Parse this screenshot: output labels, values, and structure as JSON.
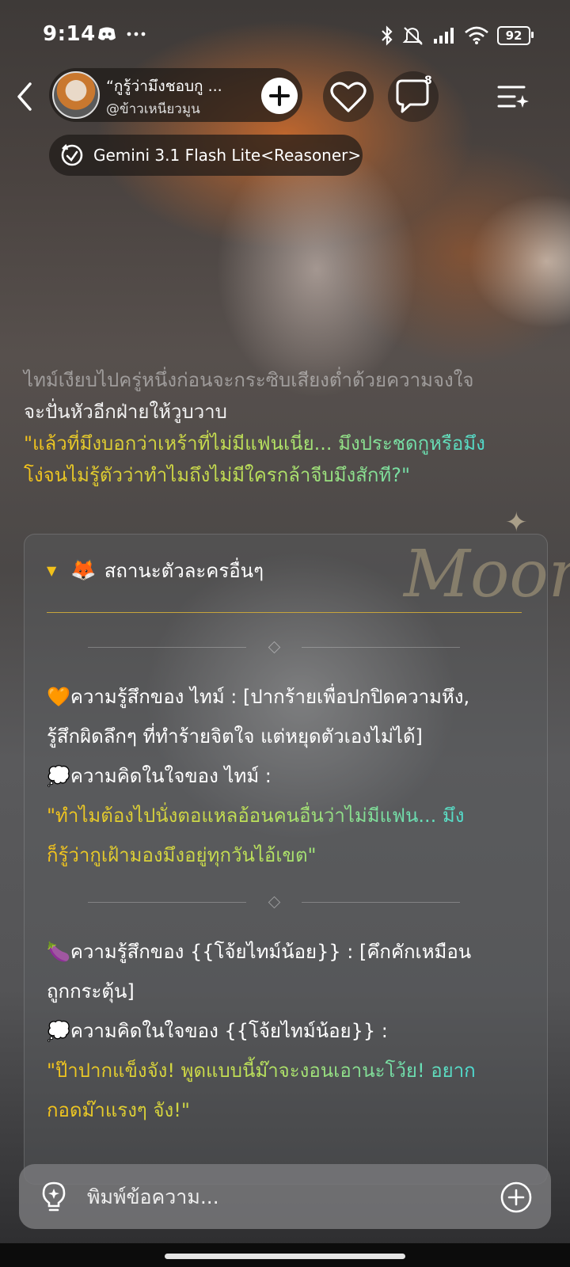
{
  "status_bar": {
    "time": "9:14",
    "left_icons": "discord-icon, more-dots-icon",
    "right_icons": "bluetooth-icon, mute-icon, signal-icon, wifi-icon",
    "battery": "92"
  },
  "header": {
    "chat_title": "“กูรู้ว่ามึงชอบกู ...",
    "creator_handle": "@ข้าวเหนียวมูน",
    "comment_count": "8",
    "model_name": "Gemini 3.1 Flash Lite<Reasoner>"
  },
  "narrative": {
    "line1": "ไทม์เงียบไปครู่หนึ่งก่อนจะกระซิบเสียงต่ำด้วยความจงใจ",
    "line2": "จะปั่นหัวอีกฝ่ายให้วูบวาบ",
    "line3": "\"แล้วที่มึงบอกว่าเหร้าที่ไม่มีแฟนเนี่ย... มึงประชดกูหรือมึง",
    "line4": "โง่จนไม่รู้ตัวว่าทำไมถึงไม่มีใครกล้าจีบมึงสักที?\""
  },
  "watermark": "Moonlo",
  "card": {
    "header_label": "สถานะตัวละครอื่นๆ",
    "block1": {
      "emoji": "🧡",
      "feeling_line1": "ความรู้สึกของ ไทม์ : [ปากร้ายเพื่อปกปิดความหึง,",
      "feeling_line2": "รู้สึกผิดลึกๆ ที่ทำร้ายจิตใจ แต่หยุดตัวเองไม่ได้]",
      "thought_emoji": "💭",
      "thought_label": "ความคิดในใจของ ไทม์ :",
      "quote_line1": "\"ทำไมต้องไปนั่งตอแหลอ้อนคนอื่นว่าไม่มีแฟน... มึง",
      "quote_line2": "ก็รู้ว่ากูเฝ้ามองมึงอยู่ทุกวันไอ้เขต\""
    },
    "block2": {
      "emoji": "🍆",
      "feeling_line1": "ความรู้สึกของ {{โจ้ยไทม์น้อย}} : [คึกคักเหมือน",
      "feeling_line2": "ถูกกระตุ้น]",
      "thought_emoji": "💭",
      "thought_label": "ความคิดในใจของ {{โจ้ยไทม์น้อย}} :",
      "quote_line1": "\"ป๊าปากแข็งจัง! พูดแบบนี้ม๊าจะงอนเอานะโว้ย! อยาก",
      "quote_line2": "กอดม๊าแรงๆ จัง!\""
    }
  },
  "input": {
    "placeholder": "พิมพ์ข้อความ..."
  }
}
